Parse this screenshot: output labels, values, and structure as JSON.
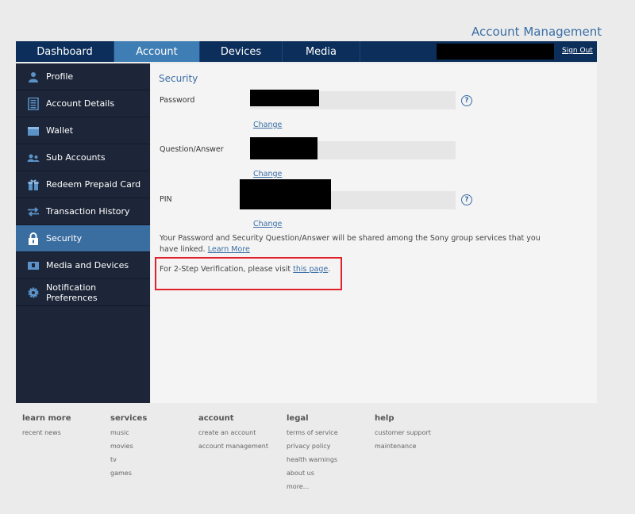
{
  "header": {
    "title": "Account Management",
    "sign_out": "Sign Out"
  },
  "topnav": {
    "tabs": [
      {
        "label": "Dashboard"
      },
      {
        "label": "Account"
      },
      {
        "label": "Devices"
      },
      {
        "label": "Media"
      }
    ]
  },
  "sidebar": {
    "items": [
      {
        "label": "Profile",
        "icon": "person-icon"
      },
      {
        "label": "Account Details",
        "icon": "document-icon"
      },
      {
        "label": "Wallet",
        "icon": "wallet-icon"
      },
      {
        "label": "Sub Accounts",
        "icon": "people-icon"
      },
      {
        "label": "Redeem Prepaid Card",
        "icon": "gift-icon"
      },
      {
        "label": "Transaction History",
        "icon": "transfer-icon"
      },
      {
        "label": "Security",
        "icon": "lock-icon"
      },
      {
        "label": "Media and Devices",
        "icon": "device-icon"
      },
      {
        "label": "Notification Preferences",
        "icon": "gear-icon"
      }
    ]
  },
  "security": {
    "title": "Security",
    "password_label": "Password",
    "question_label": "Question/Answer",
    "pin_label": "PIN",
    "change_label": "Change",
    "help_glyph": "?",
    "info_text": "Your Password and Security Question/Answer will be shared among the Sony group services that you have linked.",
    "learn_more": "Learn More",
    "two_step_text": "For 2-Step Verification, please visit",
    "two_step_link": "this page",
    "two_step_end": "."
  },
  "footer": {
    "columns": [
      {
        "heading": "learn more",
        "links": [
          "recent news"
        ]
      },
      {
        "heading": "services",
        "links": [
          "music",
          "movies",
          "tv",
          "games"
        ]
      },
      {
        "heading": "account",
        "links": [
          "create an account",
          "account management"
        ]
      },
      {
        "heading": "legal",
        "links": [
          "terms of service",
          "privacy policy",
          "health warnings",
          "about us",
          "more..."
        ]
      },
      {
        "heading": "help",
        "links": [
          "customer support",
          "maintenance"
        ]
      }
    ]
  }
}
